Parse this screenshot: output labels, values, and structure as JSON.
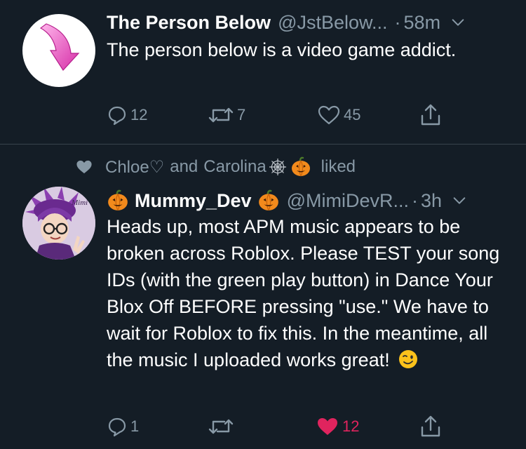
{
  "tweets": [
    {
      "author_name": "The Person Below",
      "handle": "@JstBelow...",
      "dot": "·",
      "time": "58m",
      "text": "The person below is a video game addict.",
      "replies": "12",
      "retweets": "7",
      "likes": "45",
      "liked_by_me": false
    },
    {
      "social_context": {
        "user1": "Chloe♡",
        "and": "and",
        "user2": "Carolina",
        "suffix": "liked"
      },
      "author_name": "Mummy_Dev",
      "handle": "@MimiDevR...",
      "dot": "·",
      "time": "3h",
      "text": "Heads up, most APM music appears to be broken across Roblox. Please TEST your song IDs (with the green play button) in Dance Your Blox Off BEFORE pressing \"use.\" We have to wait for Roblox to fix this. In the meantime, all the music I uploaded works great!",
      "replies": "1",
      "retweets": "",
      "likes": "12",
      "liked_by_me": true
    }
  ],
  "colors": {
    "background": "#141d26",
    "text": "#ffffff",
    "secondary": "#8899a6",
    "divider": "#38444d",
    "like_active": "#e0245e"
  },
  "icons": {
    "reply": "reply-icon",
    "retweet": "retweet-icon",
    "like": "heart-icon",
    "share": "share-icon",
    "menu": "chevron-down-icon"
  }
}
